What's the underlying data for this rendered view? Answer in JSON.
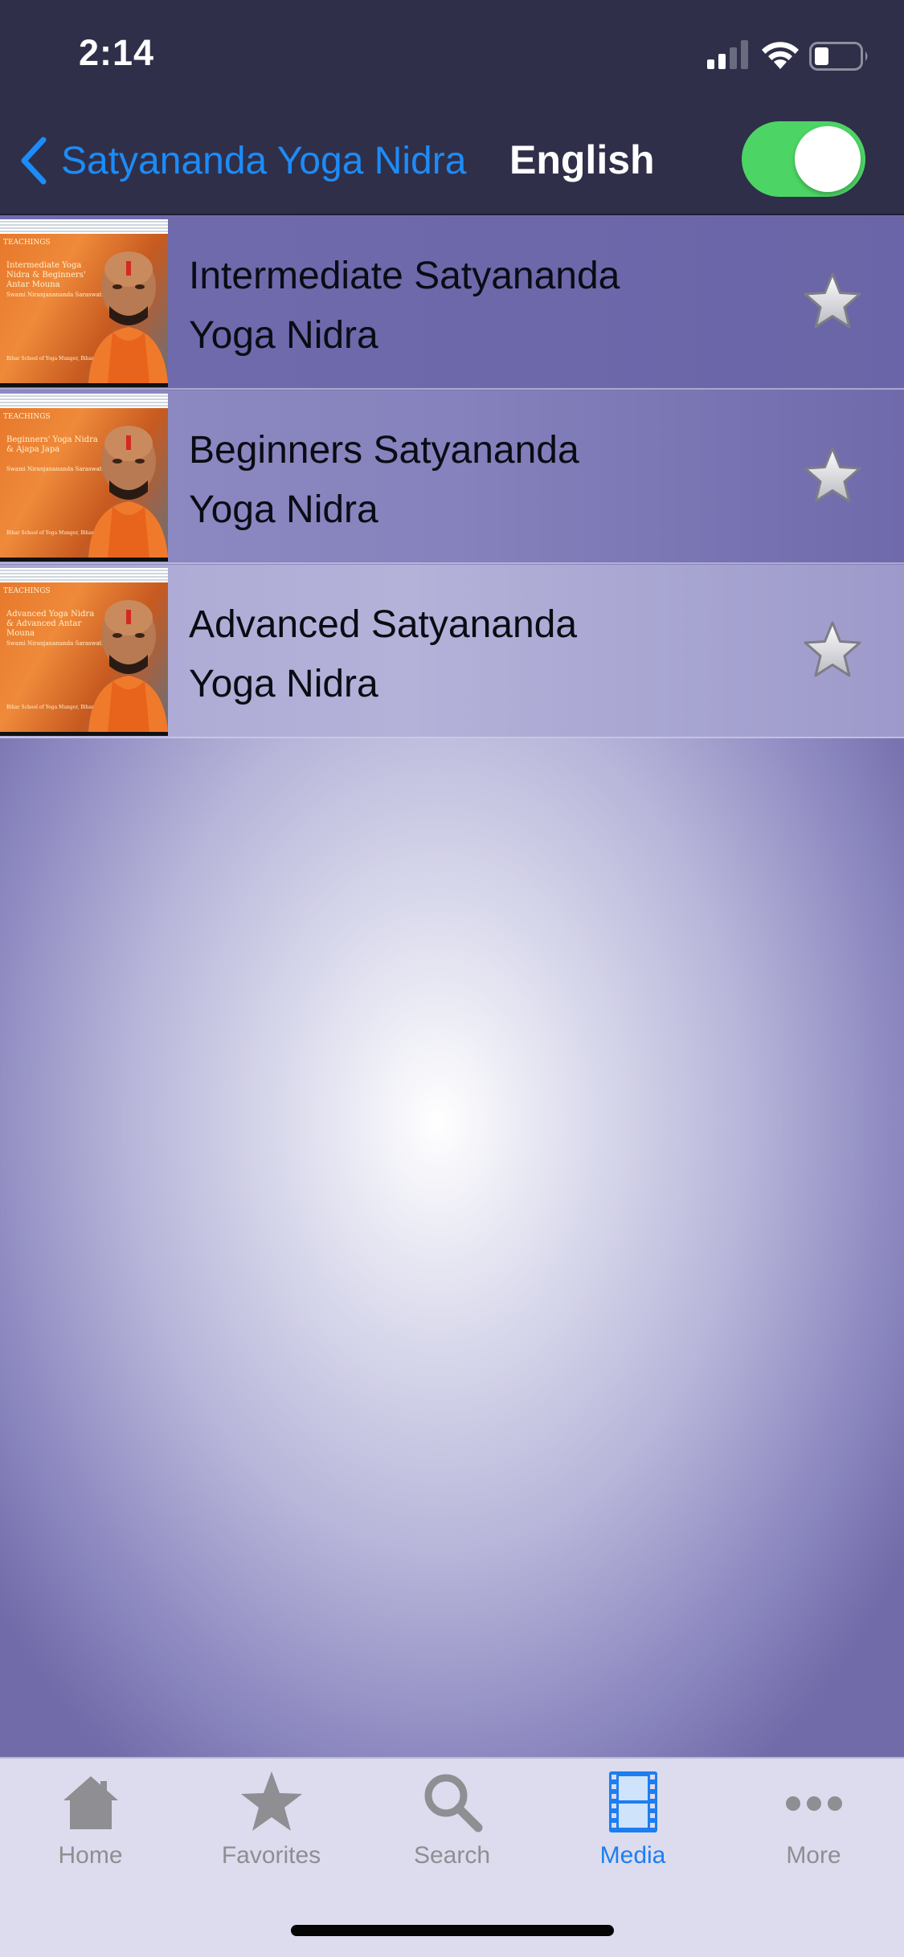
{
  "status_bar": {
    "time": "2:14"
  },
  "nav": {
    "back_label": "Satyananda Yoga Nidra",
    "title": "English",
    "toggle_on": true
  },
  "colors": {
    "nav_background": "#2f2f4a",
    "accent": "#1c8cf8",
    "toggle_on": "#4cd564",
    "tab_active": "#1c7ef2",
    "tab_inactive": "#8e8e93"
  },
  "items": [
    {
      "title": "Intermediate Satyananda Yoga Nidra",
      "thumb_title": "Intermediate Yoga Nidra & Beginners' Antar Mouna",
      "thumb_brand": "TEACHINGS",
      "thumb_author": "Swami Niranjanananda Saraswati",
      "thumb_pub": "Bihar School of Yoga Munger, Bihar, India",
      "favorite": false
    },
    {
      "title": "Beginners Satyananda Yoga Nidra",
      "thumb_title": "Beginners' Yoga Nidra & Ajapa Japa",
      "thumb_brand": "TEACHINGS",
      "thumb_author": "Swami Niranjanananda Saraswati",
      "thumb_pub": "Bihar School of Yoga Munger, Bihar, India",
      "favorite": false
    },
    {
      "title": "Advanced Satyananda Yoga Nidra",
      "thumb_title": "Advanced Yoga Nidra & Advanced Antar Mouna",
      "thumb_brand": "TEACHINGS",
      "thumb_author": "Swami Niranjanananda Saraswati",
      "thumb_pub": "Bihar School of Yoga Munger, Bihar, India",
      "favorite": false
    }
  ],
  "tabs": [
    {
      "label": "Home",
      "icon": "house-icon",
      "active": false
    },
    {
      "label": "Favorites",
      "icon": "star-icon",
      "active": false
    },
    {
      "label": "Search",
      "icon": "magnifier-icon",
      "active": false
    },
    {
      "label": "Media",
      "icon": "film-icon",
      "active": true
    },
    {
      "label": "More",
      "icon": "ellipsis-icon",
      "active": false
    }
  ]
}
